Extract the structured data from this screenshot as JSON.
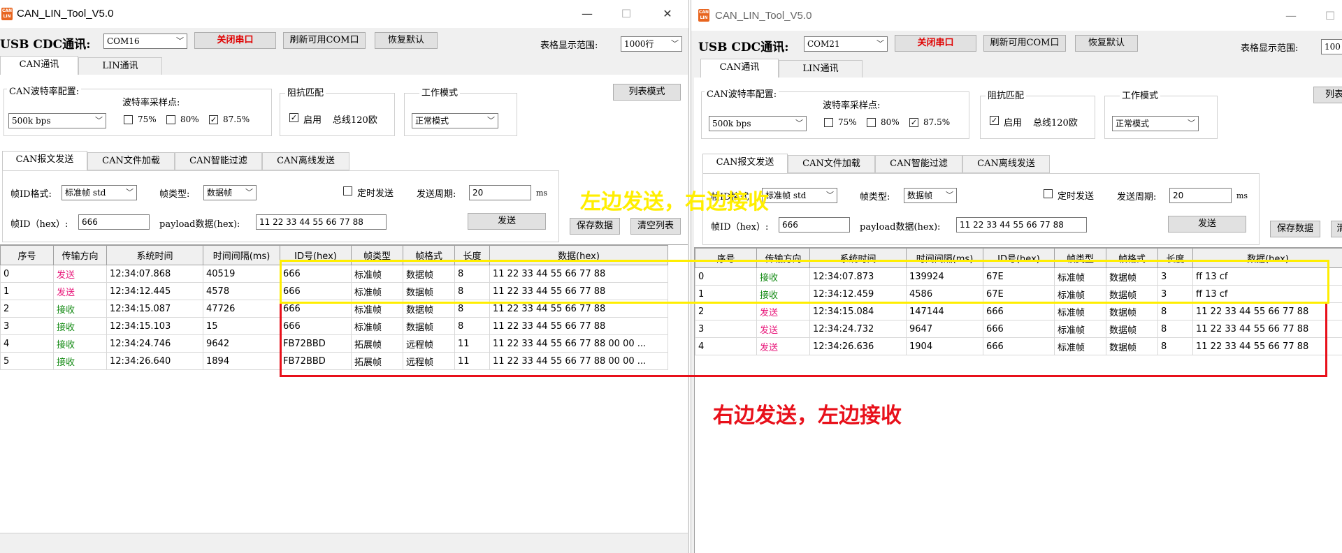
{
  "app_title": "CAN_LIN_Tool_V5.0",
  "icon_text": "CAN LIN",
  "window_controls": {
    "minimize": "—",
    "maximize": "☐",
    "close": "✕"
  },
  "left": {
    "usb_label": "USB CDC通讯:",
    "port": "COM16",
    "close_port": "关闭串口",
    "refresh": "刷新可用COM口",
    "restore": "恢复默认",
    "range_label": "表格显示范围:",
    "range_value": "1000行",
    "tabs": [
      "CAN通讯",
      "LIN通讯"
    ],
    "baud_group": "CAN波特率配置:",
    "baud": "500k bps",
    "sample_label": "波特率采样点:",
    "samples": [
      "75%",
      "80%",
      "87.5%"
    ],
    "impedance_group": "阻抗匹配",
    "impedance_enable": "启用",
    "impedance_total": "总线120欧",
    "mode_group": "工作模式",
    "mode": "正常模式",
    "list_mode": "列表模式",
    "subtabs": [
      "CAN报文发送",
      "CAN文件加载",
      "CAN智能过滤",
      "CAN离线发送"
    ],
    "frame_format_label": "帧ID格式:",
    "frame_format": "标准帧 std",
    "frame_type_label": "帧类型:",
    "frame_type": "数据帧",
    "timed_send": "定时发送",
    "period_label": "发送周期:",
    "period": "20",
    "period_unit": "ms",
    "frame_id_label": "帧ID（hex）:",
    "frame_id": "666",
    "payload_label": "payload数据(hex):",
    "payload": "11 22 33 44 55 66 77 88",
    "send": "发送",
    "save": "保存数据",
    "clear": "清空列表",
    "columns": [
      "序号",
      "传输方向",
      "系统时间",
      "时间间隔(ms)",
      "ID号(hex)",
      "帧类型",
      "帧格式",
      "长度",
      "数据(hex)"
    ],
    "rows": [
      [
        "0",
        "发送",
        "12:34:07.868",
        "40519",
        "666",
        "标准帧",
        "数据帧",
        "8",
        "11 22 33 44 55 66 77 88"
      ],
      [
        "1",
        "发送",
        "12:34:12.445",
        "4578",
        "666",
        "标准帧",
        "数据帧",
        "8",
        "11 22 33 44 55 66 77 88"
      ],
      [
        "2",
        "接收",
        "12:34:15.087",
        "47726",
        "666",
        "标准帧",
        "数据帧",
        "8",
        "11 22 33 44 55 66 77 88"
      ],
      [
        "3",
        "接收",
        "12:34:15.103",
        "15",
        "666",
        "标准帧",
        "数据帧",
        "8",
        "11 22 33 44 55 66 77 88"
      ],
      [
        "4",
        "接收",
        "12:34:24.746",
        "9642",
        "FB72BBD",
        "拓展帧",
        "远程帧",
        "11",
        "11 22 33 44 55 66 77 88 00 00 ..."
      ],
      [
        "5",
        "接收",
        "12:34:26.640",
        "1894",
        "FB72BBD",
        "拓展帧",
        "远程帧",
        "11",
        "11 22 33 44 55 66 77 88 00 00 ..."
      ]
    ]
  },
  "right": {
    "usb_label": "USB CDC通讯:",
    "port": "COM21",
    "close_port": "关闭串口",
    "refresh": "刷新可用COM口",
    "restore": "恢复默认",
    "range_label": "表格显示范围:",
    "range_value": "100",
    "tabs": [
      "CAN通讯",
      "LIN通讯"
    ],
    "baud_group": "CAN波特率配置:",
    "baud": "500k bps",
    "sample_label": "波特率采样点:",
    "samples": [
      "75%",
      "80%",
      "87.5%"
    ],
    "impedance_group": "阻抗匹配",
    "impedance_enable": "启用",
    "impedance_total": "总线120欧",
    "mode_group": "工作模式",
    "mode": "正常模式",
    "list_mode": "列表",
    "subtabs": [
      "CAN报文发送",
      "CAN文件加载",
      "CAN智能过滤",
      "CAN离线发送"
    ],
    "frame_format_label": "帧ID格式:",
    "frame_format": "标准帧 std",
    "frame_type_label": "帧类型:",
    "frame_type": "数据帧",
    "timed_send": "定时发送",
    "period_label": "发送周期:",
    "period": "20",
    "period_unit": "ms",
    "frame_id_label": "帧ID（hex）:",
    "frame_id": "666",
    "payload_label": "payload数据(hex):",
    "payload": "11 22 33 44 55 66 77 88",
    "send": "发送",
    "save": "保存数据",
    "clear": "清",
    "columns": [
      "序号",
      "传输方向",
      "系统时间",
      "时间间隔(ms)",
      "ID号(hex)",
      "帧类型",
      "帧格式",
      "长度",
      "数据(hex)"
    ],
    "rows": [
      [
        "0",
        "接收",
        "12:34:07.873",
        "139924",
        "67E",
        "标准帧",
        "数据帧",
        "3",
        "ff 13 cf"
      ],
      [
        "1",
        "接收",
        "12:34:12.459",
        "4586",
        "67E",
        "标准帧",
        "数据帧",
        "3",
        "ff 13 cf"
      ],
      [
        "2",
        "发送",
        "12:34:15.084",
        "147144",
        "666",
        "标准帧",
        "数据帧",
        "8",
        "11 22 33 44 55 66 77 88"
      ],
      [
        "3",
        "发送",
        "12:34:24.732",
        "9647",
        "666",
        "标准帧",
        "数据帧",
        "8",
        "11 22 33 44 55 66 77 88"
      ],
      [
        "4",
        "发送",
        "12:34:26.636",
        "1904",
        "666",
        "标准帧",
        "数据帧",
        "8",
        "11 22 33 44 55 66 77 88"
      ]
    ]
  },
  "annotations": {
    "left_send_right_receive": "左边发送，右边接收",
    "right_send_left_receive": "右边发送，左边接收",
    "yellow": "#ffee00",
    "red": "#e8101a"
  },
  "colors": {
    "send": "#e8177a",
    "receive": "#138a13",
    "close_port": "#e00000"
  }
}
